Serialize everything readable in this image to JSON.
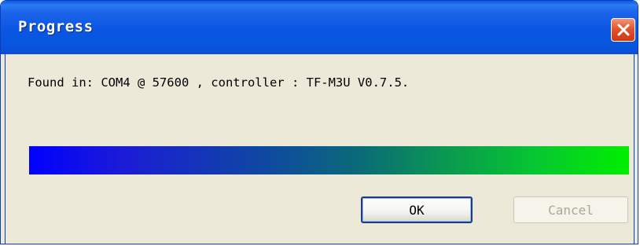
{
  "window": {
    "title": "Progress"
  },
  "message": "Found in: COM4 @ 57600 , controller : TF-M3U V0.7.5.",
  "progress": {
    "value_percent": 100,
    "gradient_start_color": "#0000ff",
    "gradient_end_color": "#00ee00"
  },
  "buttons": {
    "ok_label": "OK",
    "cancel_label": "Cancel",
    "cancel_enabled": false
  },
  "colors": {
    "titlebar": "#0a55e2",
    "close_button": "#e0542e",
    "dialog_background": "#ece9d8"
  },
  "icons": {
    "close": "close-icon"
  }
}
